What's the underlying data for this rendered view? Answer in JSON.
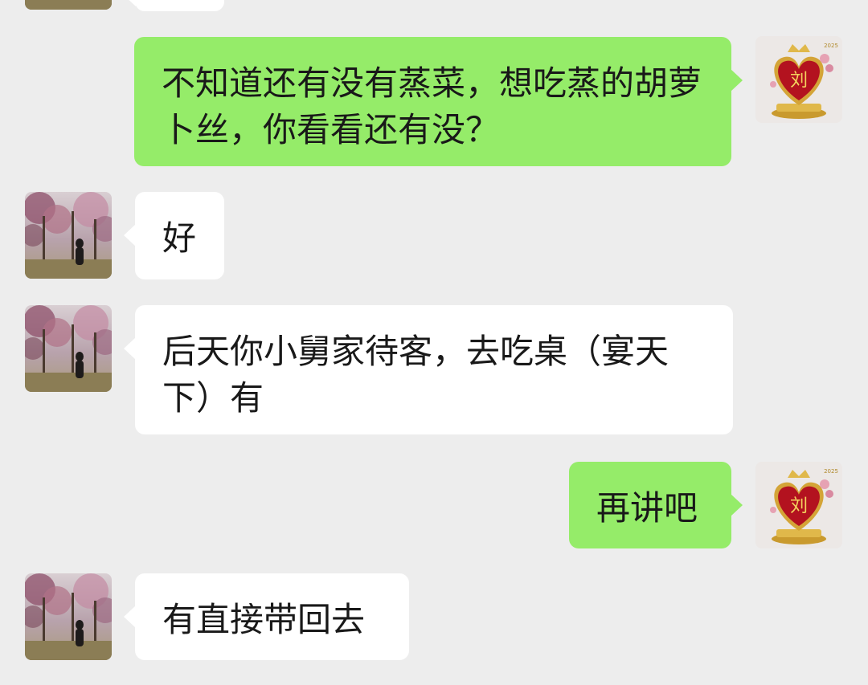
{
  "colors": {
    "background": "#ededed",
    "incoming_bubble": "#ffffff",
    "outgoing_bubble": "#95ec69",
    "text": "#191919"
  },
  "self_avatar": {
    "glyph": "刘",
    "year": "2025"
  },
  "messages": [
    {
      "from": "other",
      "text": ""
    },
    {
      "from": "self",
      "text": "不知道还有没有蒸菜，想吃蒸的胡萝卜丝，你看看还有没？"
    },
    {
      "from": "other",
      "text": "好"
    },
    {
      "from": "other",
      "text": "后天你小舅家待客，去吃桌（宴天下）有"
    },
    {
      "from": "self",
      "text": "再讲吧"
    },
    {
      "from": "other",
      "text": "有直接带回去"
    }
  ]
}
